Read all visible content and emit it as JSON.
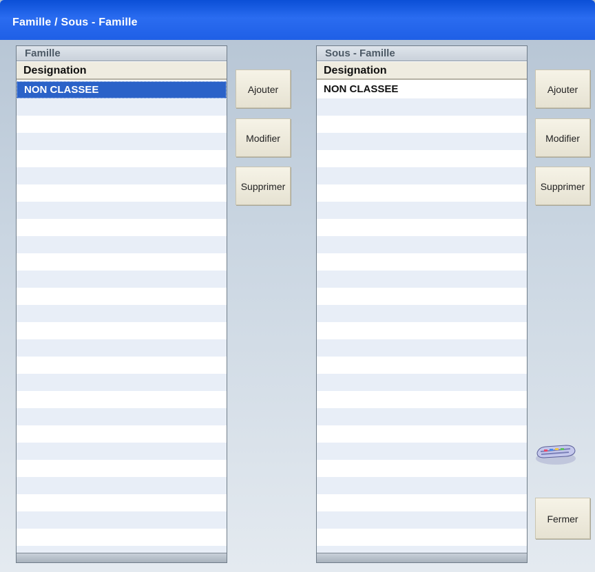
{
  "window": {
    "title": "Famille / Sous - Famille"
  },
  "famille": {
    "panel_title": "Famille",
    "column_header": "Designation",
    "rows": [
      "NON CLASSEE"
    ],
    "selected_index": 0
  },
  "sous_famille": {
    "panel_title": "Sous - Famille",
    "column_header": "Designation",
    "rows": [
      "NON CLASSEE"
    ]
  },
  "famille_buttons": {
    "add": "Ajouter",
    "edit": "Modifier",
    "delete": "Supprimer"
  },
  "sous_famille_buttons": {
    "add": "Ajouter",
    "edit": "Modifier",
    "delete": "Supprimer"
  },
  "close_button": "Fermer",
  "icons": {
    "keyboard": "keyboard-icon"
  }
}
